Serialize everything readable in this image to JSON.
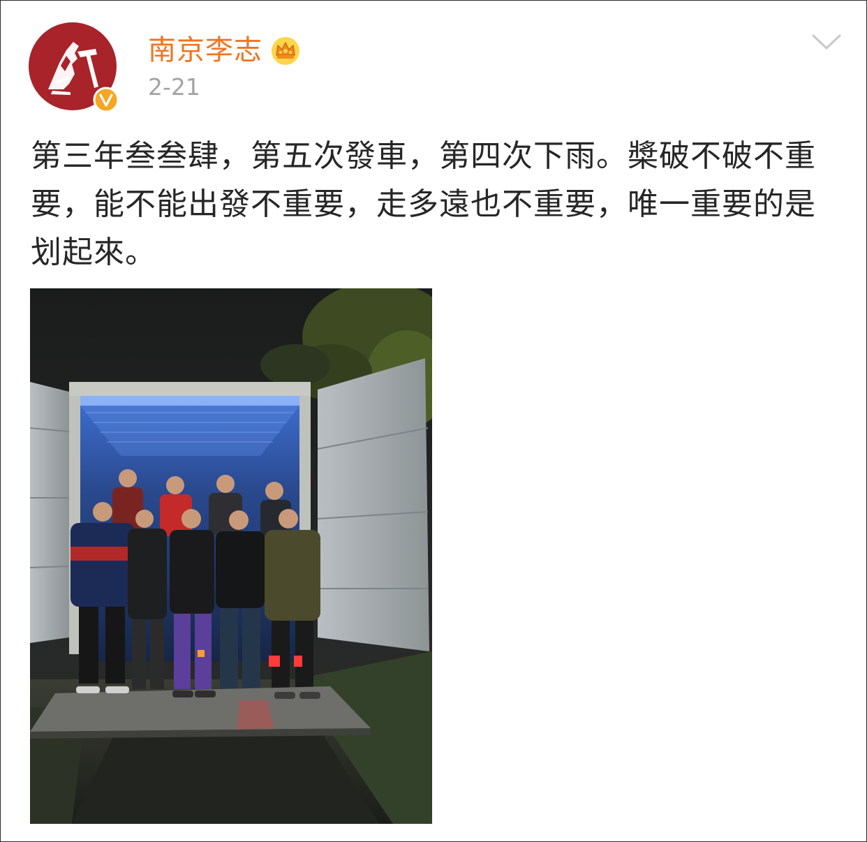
{
  "post": {
    "username": "南京李志",
    "date": "2-21",
    "text": "第三年叁叁肆，第五次發車，第四次下雨。槳破不破不重要，能不能出發不重要，走多遠也不重要，唯一重要的是划起來。"
  },
  "icons": {
    "avatar": "red-circle-logo-avatar",
    "verified": "verified-v-badge-icon",
    "crown": "crown-membership-icon",
    "menu": "chevron-down-icon"
  },
  "colors": {
    "username": "#f0731f",
    "date": "#a3a3a3",
    "text": "#262626",
    "avatar_red": "#a8232a",
    "verified_badge": "#f5a623",
    "chevron": "#c8c8c8"
  }
}
